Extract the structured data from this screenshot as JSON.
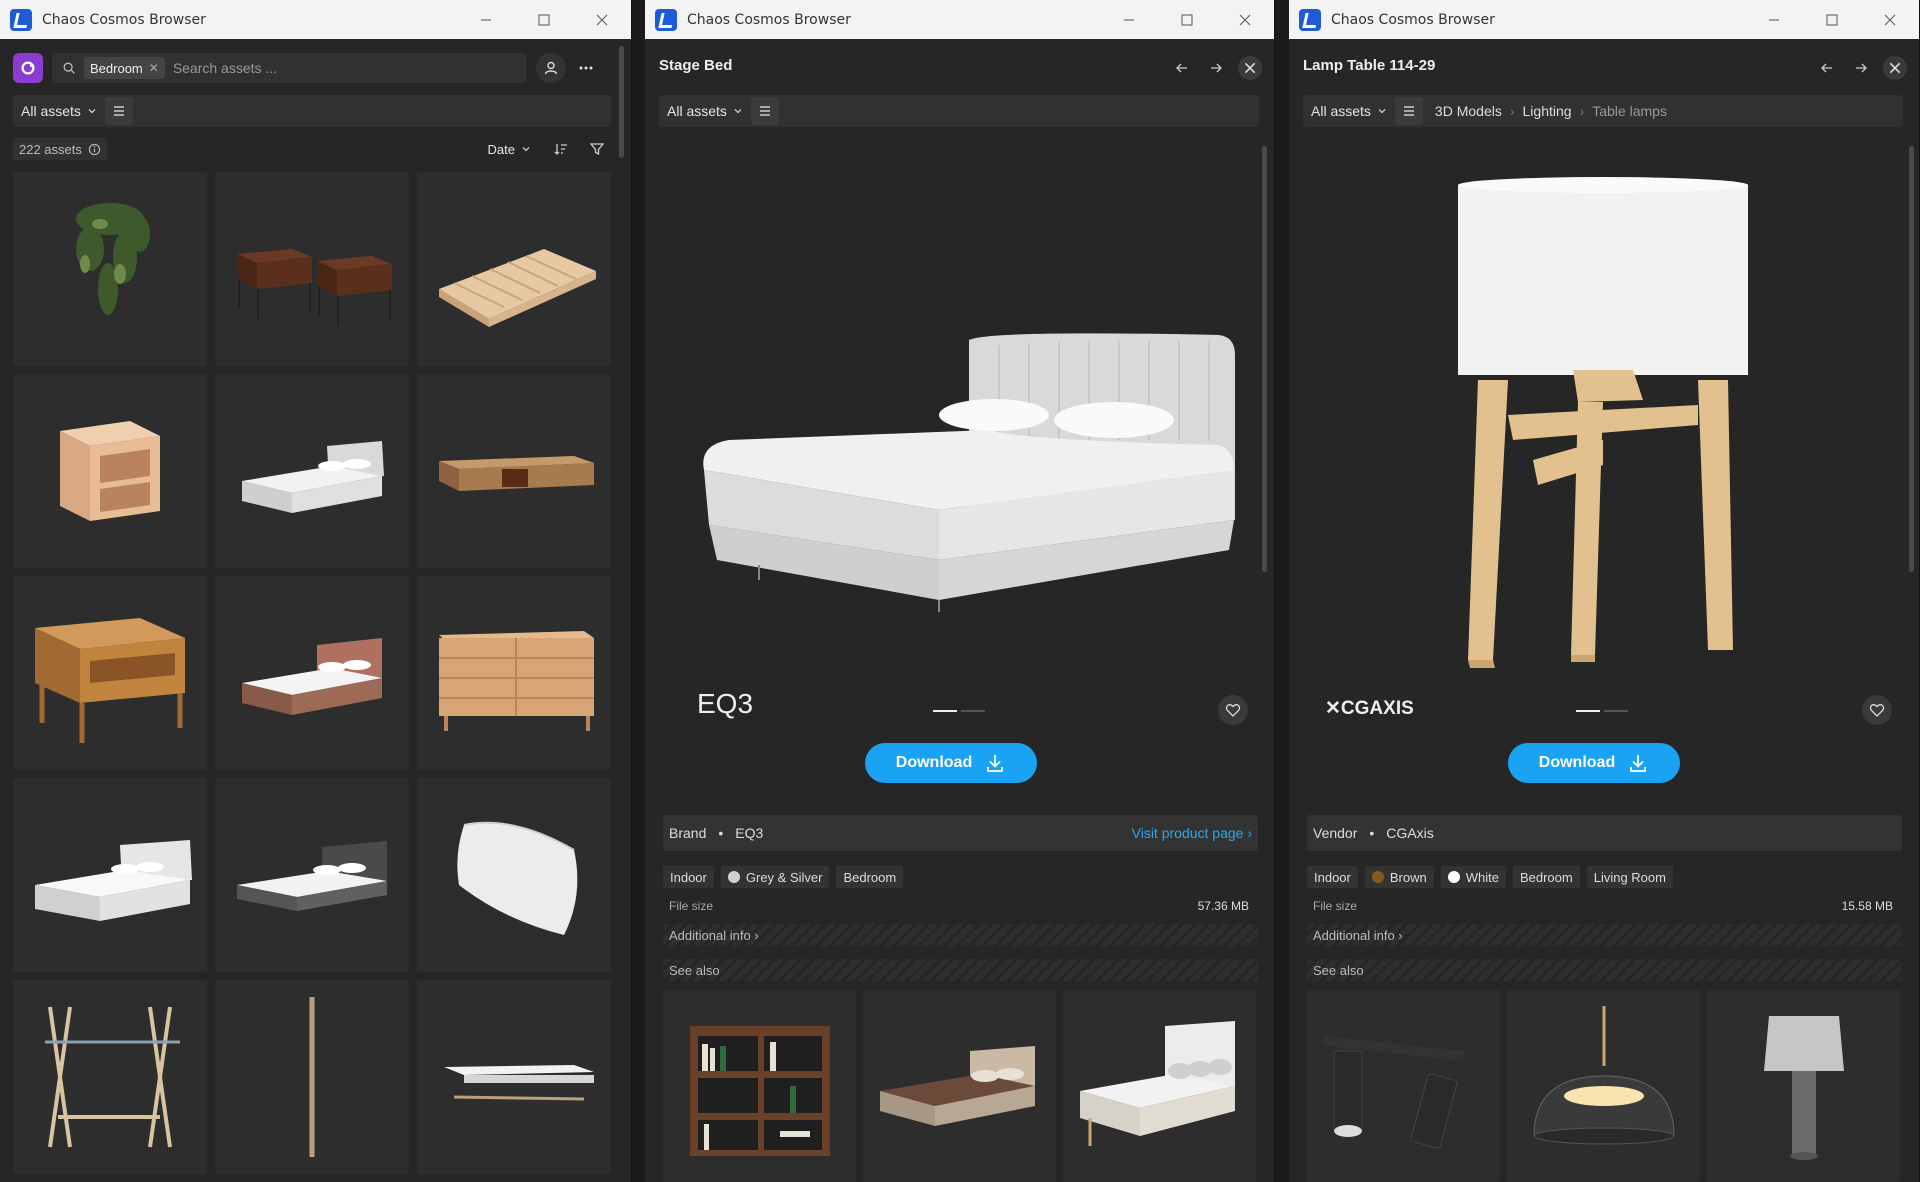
{
  "windows": [
    {
      "title": "Chaos Cosmos Browser"
    },
    {
      "title": "Chaos Cosmos Browser"
    },
    {
      "title": "Chaos Cosmos Browser"
    }
  ],
  "browser": {
    "search_chip": "Bedroom",
    "search_placeholder": "Search assets ...",
    "filter_label": "All assets",
    "count_label": "222 assets",
    "sort_label": "Date",
    "tiles": [
      "hanging plant",
      "two nightstands",
      "platform bed frame",
      "open nightstand",
      "upholstered bed",
      "low sideboard",
      "oak nightstand",
      "wood bed",
      "dresser",
      "white bed",
      "grey bed",
      "cushion",
      "clothes rack",
      "pole",
      "wall shelf"
    ]
  },
  "detail1": {
    "title": "Stage Bed",
    "filter_label": "All assets",
    "brand_logo": "EQ3",
    "download_label": "Download",
    "info_key": "Brand",
    "info_value": "EQ3",
    "info_link": "Visit product page ›",
    "tags": [
      {
        "label": "Indoor"
      },
      {
        "label": "Grey & Silver",
        "color": "#d0d0d0"
      },
      {
        "label": "Bedroom"
      }
    ],
    "file_size_label": "File size",
    "file_size_value": "57.36 MB",
    "additional_info": "Additional info  ›",
    "see_also": "See also"
  },
  "detail2": {
    "title": "Lamp Table 114-29",
    "filter_label": "All assets",
    "breadcrumb": [
      "3D Models",
      "Lighting",
      "Table lamps"
    ],
    "brand_logo": "✕CGAXIS",
    "download_label": "Download",
    "info_key": "Vendor",
    "info_value": "CGAxis",
    "tags": [
      {
        "label": "Indoor"
      },
      {
        "label": "Brown",
        "color": "#8a5a1a"
      },
      {
        "label": "White",
        "color": "#ffffff"
      },
      {
        "label": "Bedroom"
      },
      {
        "label": "Living Room"
      }
    ],
    "file_size_label": "File size",
    "file_size_value": "15.58 MB",
    "additional_info": "Additional info  ›",
    "see_also": "See also"
  },
  "colors": {
    "accent": "#1aa3f2",
    "link": "#2ba6f0",
    "panel": "#262626"
  }
}
